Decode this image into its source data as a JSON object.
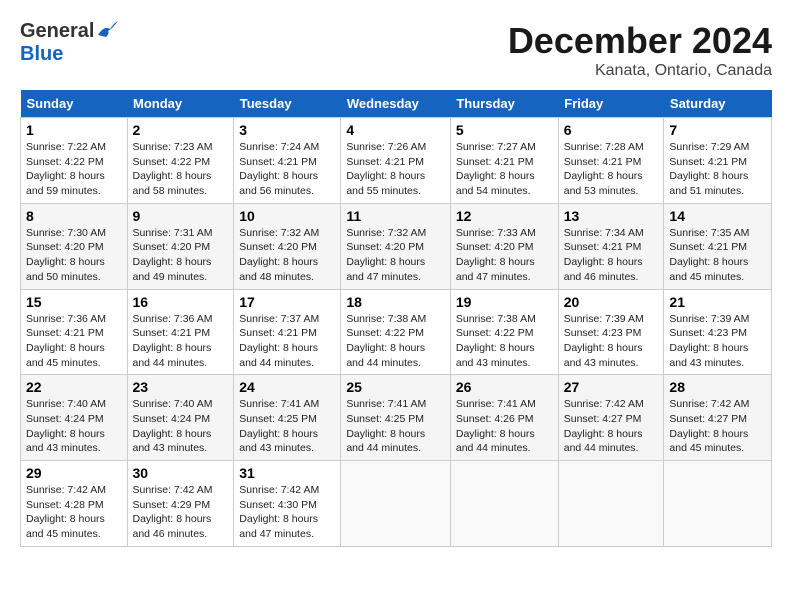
{
  "header": {
    "logo_general": "General",
    "logo_blue": "Blue",
    "main_title": "December 2024",
    "subtitle": "Kanata, Ontario, Canada"
  },
  "weekdays": [
    "Sunday",
    "Monday",
    "Tuesday",
    "Wednesday",
    "Thursday",
    "Friday",
    "Saturday"
  ],
  "weeks": [
    [
      {
        "day": "1",
        "rise": "Sunrise: 7:22 AM",
        "set": "Sunset: 4:22 PM",
        "daylight": "Daylight: 8 hours and 59 minutes."
      },
      {
        "day": "2",
        "rise": "Sunrise: 7:23 AM",
        "set": "Sunset: 4:22 PM",
        "daylight": "Daylight: 8 hours and 58 minutes."
      },
      {
        "day": "3",
        "rise": "Sunrise: 7:24 AM",
        "set": "Sunset: 4:21 PM",
        "daylight": "Daylight: 8 hours and 56 minutes."
      },
      {
        "day": "4",
        "rise": "Sunrise: 7:26 AM",
        "set": "Sunset: 4:21 PM",
        "daylight": "Daylight: 8 hours and 55 minutes."
      },
      {
        "day": "5",
        "rise": "Sunrise: 7:27 AM",
        "set": "Sunset: 4:21 PM",
        "daylight": "Daylight: 8 hours and 54 minutes."
      },
      {
        "day": "6",
        "rise": "Sunrise: 7:28 AM",
        "set": "Sunset: 4:21 PM",
        "daylight": "Daylight: 8 hours and 53 minutes."
      },
      {
        "day": "7",
        "rise": "Sunrise: 7:29 AM",
        "set": "Sunset: 4:21 PM",
        "daylight": "Daylight: 8 hours and 51 minutes."
      }
    ],
    [
      {
        "day": "8",
        "rise": "Sunrise: 7:30 AM",
        "set": "Sunset: 4:20 PM",
        "daylight": "Daylight: 8 hours and 50 minutes."
      },
      {
        "day": "9",
        "rise": "Sunrise: 7:31 AM",
        "set": "Sunset: 4:20 PM",
        "daylight": "Daylight: 8 hours and 49 minutes."
      },
      {
        "day": "10",
        "rise": "Sunrise: 7:32 AM",
        "set": "Sunset: 4:20 PM",
        "daylight": "Daylight: 8 hours and 48 minutes."
      },
      {
        "day": "11",
        "rise": "Sunrise: 7:32 AM",
        "set": "Sunset: 4:20 PM",
        "daylight": "Daylight: 8 hours and 47 minutes."
      },
      {
        "day": "12",
        "rise": "Sunrise: 7:33 AM",
        "set": "Sunset: 4:20 PM",
        "daylight": "Daylight: 8 hours and 47 minutes."
      },
      {
        "day": "13",
        "rise": "Sunrise: 7:34 AM",
        "set": "Sunset: 4:21 PM",
        "daylight": "Daylight: 8 hours and 46 minutes."
      },
      {
        "day": "14",
        "rise": "Sunrise: 7:35 AM",
        "set": "Sunset: 4:21 PM",
        "daylight": "Daylight: 8 hours and 45 minutes."
      }
    ],
    [
      {
        "day": "15",
        "rise": "Sunrise: 7:36 AM",
        "set": "Sunset: 4:21 PM",
        "daylight": "Daylight: 8 hours and 45 minutes."
      },
      {
        "day": "16",
        "rise": "Sunrise: 7:36 AM",
        "set": "Sunset: 4:21 PM",
        "daylight": "Daylight: 8 hours and 44 minutes."
      },
      {
        "day": "17",
        "rise": "Sunrise: 7:37 AM",
        "set": "Sunset: 4:21 PM",
        "daylight": "Daylight: 8 hours and 44 minutes."
      },
      {
        "day": "18",
        "rise": "Sunrise: 7:38 AM",
        "set": "Sunset: 4:22 PM",
        "daylight": "Daylight: 8 hours and 44 minutes."
      },
      {
        "day": "19",
        "rise": "Sunrise: 7:38 AM",
        "set": "Sunset: 4:22 PM",
        "daylight": "Daylight: 8 hours and 43 minutes."
      },
      {
        "day": "20",
        "rise": "Sunrise: 7:39 AM",
        "set": "Sunset: 4:23 PM",
        "daylight": "Daylight: 8 hours and 43 minutes."
      },
      {
        "day": "21",
        "rise": "Sunrise: 7:39 AM",
        "set": "Sunset: 4:23 PM",
        "daylight": "Daylight: 8 hours and 43 minutes."
      }
    ],
    [
      {
        "day": "22",
        "rise": "Sunrise: 7:40 AM",
        "set": "Sunset: 4:24 PM",
        "daylight": "Daylight: 8 hours and 43 minutes."
      },
      {
        "day": "23",
        "rise": "Sunrise: 7:40 AM",
        "set": "Sunset: 4:24 PM",
        "daylight": "Daylight: 8 hours and 43 minutes."
      },
      {
        "day": "24",
        "rise": "Sunrise: 7:41 AM",
        "set": "Sunset: 4:25 PM",
        "daylight": "Daylight: 8 hours and 43 minutes."
      },
      {
        "day": "25",
        "rise": "Sunrise: 7:41 AM",
        "set": "Sunset: 4:25 PM",
        "daylight": "Daylight: 8 hours and 44 minutes."
      },
      {
        "day": "26",
        "rise": "Sunrise: 7:41 AM",
        "set": "Sunset: 4:26 PM",
        "daylight": "Daylight: 8 hours and 44 minutes."
      },
      {
        "day": "27",
        "rise": "Sunrise: 7:42 AM",
        "set": "Sunset: 4:27 PM",
        "daylight": "Daylight: 8 hours and 44 minutes."
      },
      {
        "day": "28",
        "rise": "Sunrise: 7:42 AM",
        "set": "Sunset: 4:27 PM",
        "daylight": "Daylight: 8 hours and 45 minutes."
      }
    ],
    [
      {
        "day": "29",
        "rise": "Sunrise: 7:42 AM",
        "set": "Sunset: 4:28 PM",
        "daylight": "Daylight: 8 hours and 45 minutes."
      },
      {
        "day": "30",
        "rise": "Sunrise: 7:42 AM",
        "set": "Sunset: 4:29 PM",
        "daylight": "Daylight: 8 hours and 46 minutes."
      },
      {
        "day": "31",
        "rise": "Sunrise: 7:42 AM",
        "set": "Sunset: 4:30 PM",
        "daylight": "Daylight: 8 hours and 47 minutes."
      },
      null,
      null,
      null,
      null
    ]
  ]
}
